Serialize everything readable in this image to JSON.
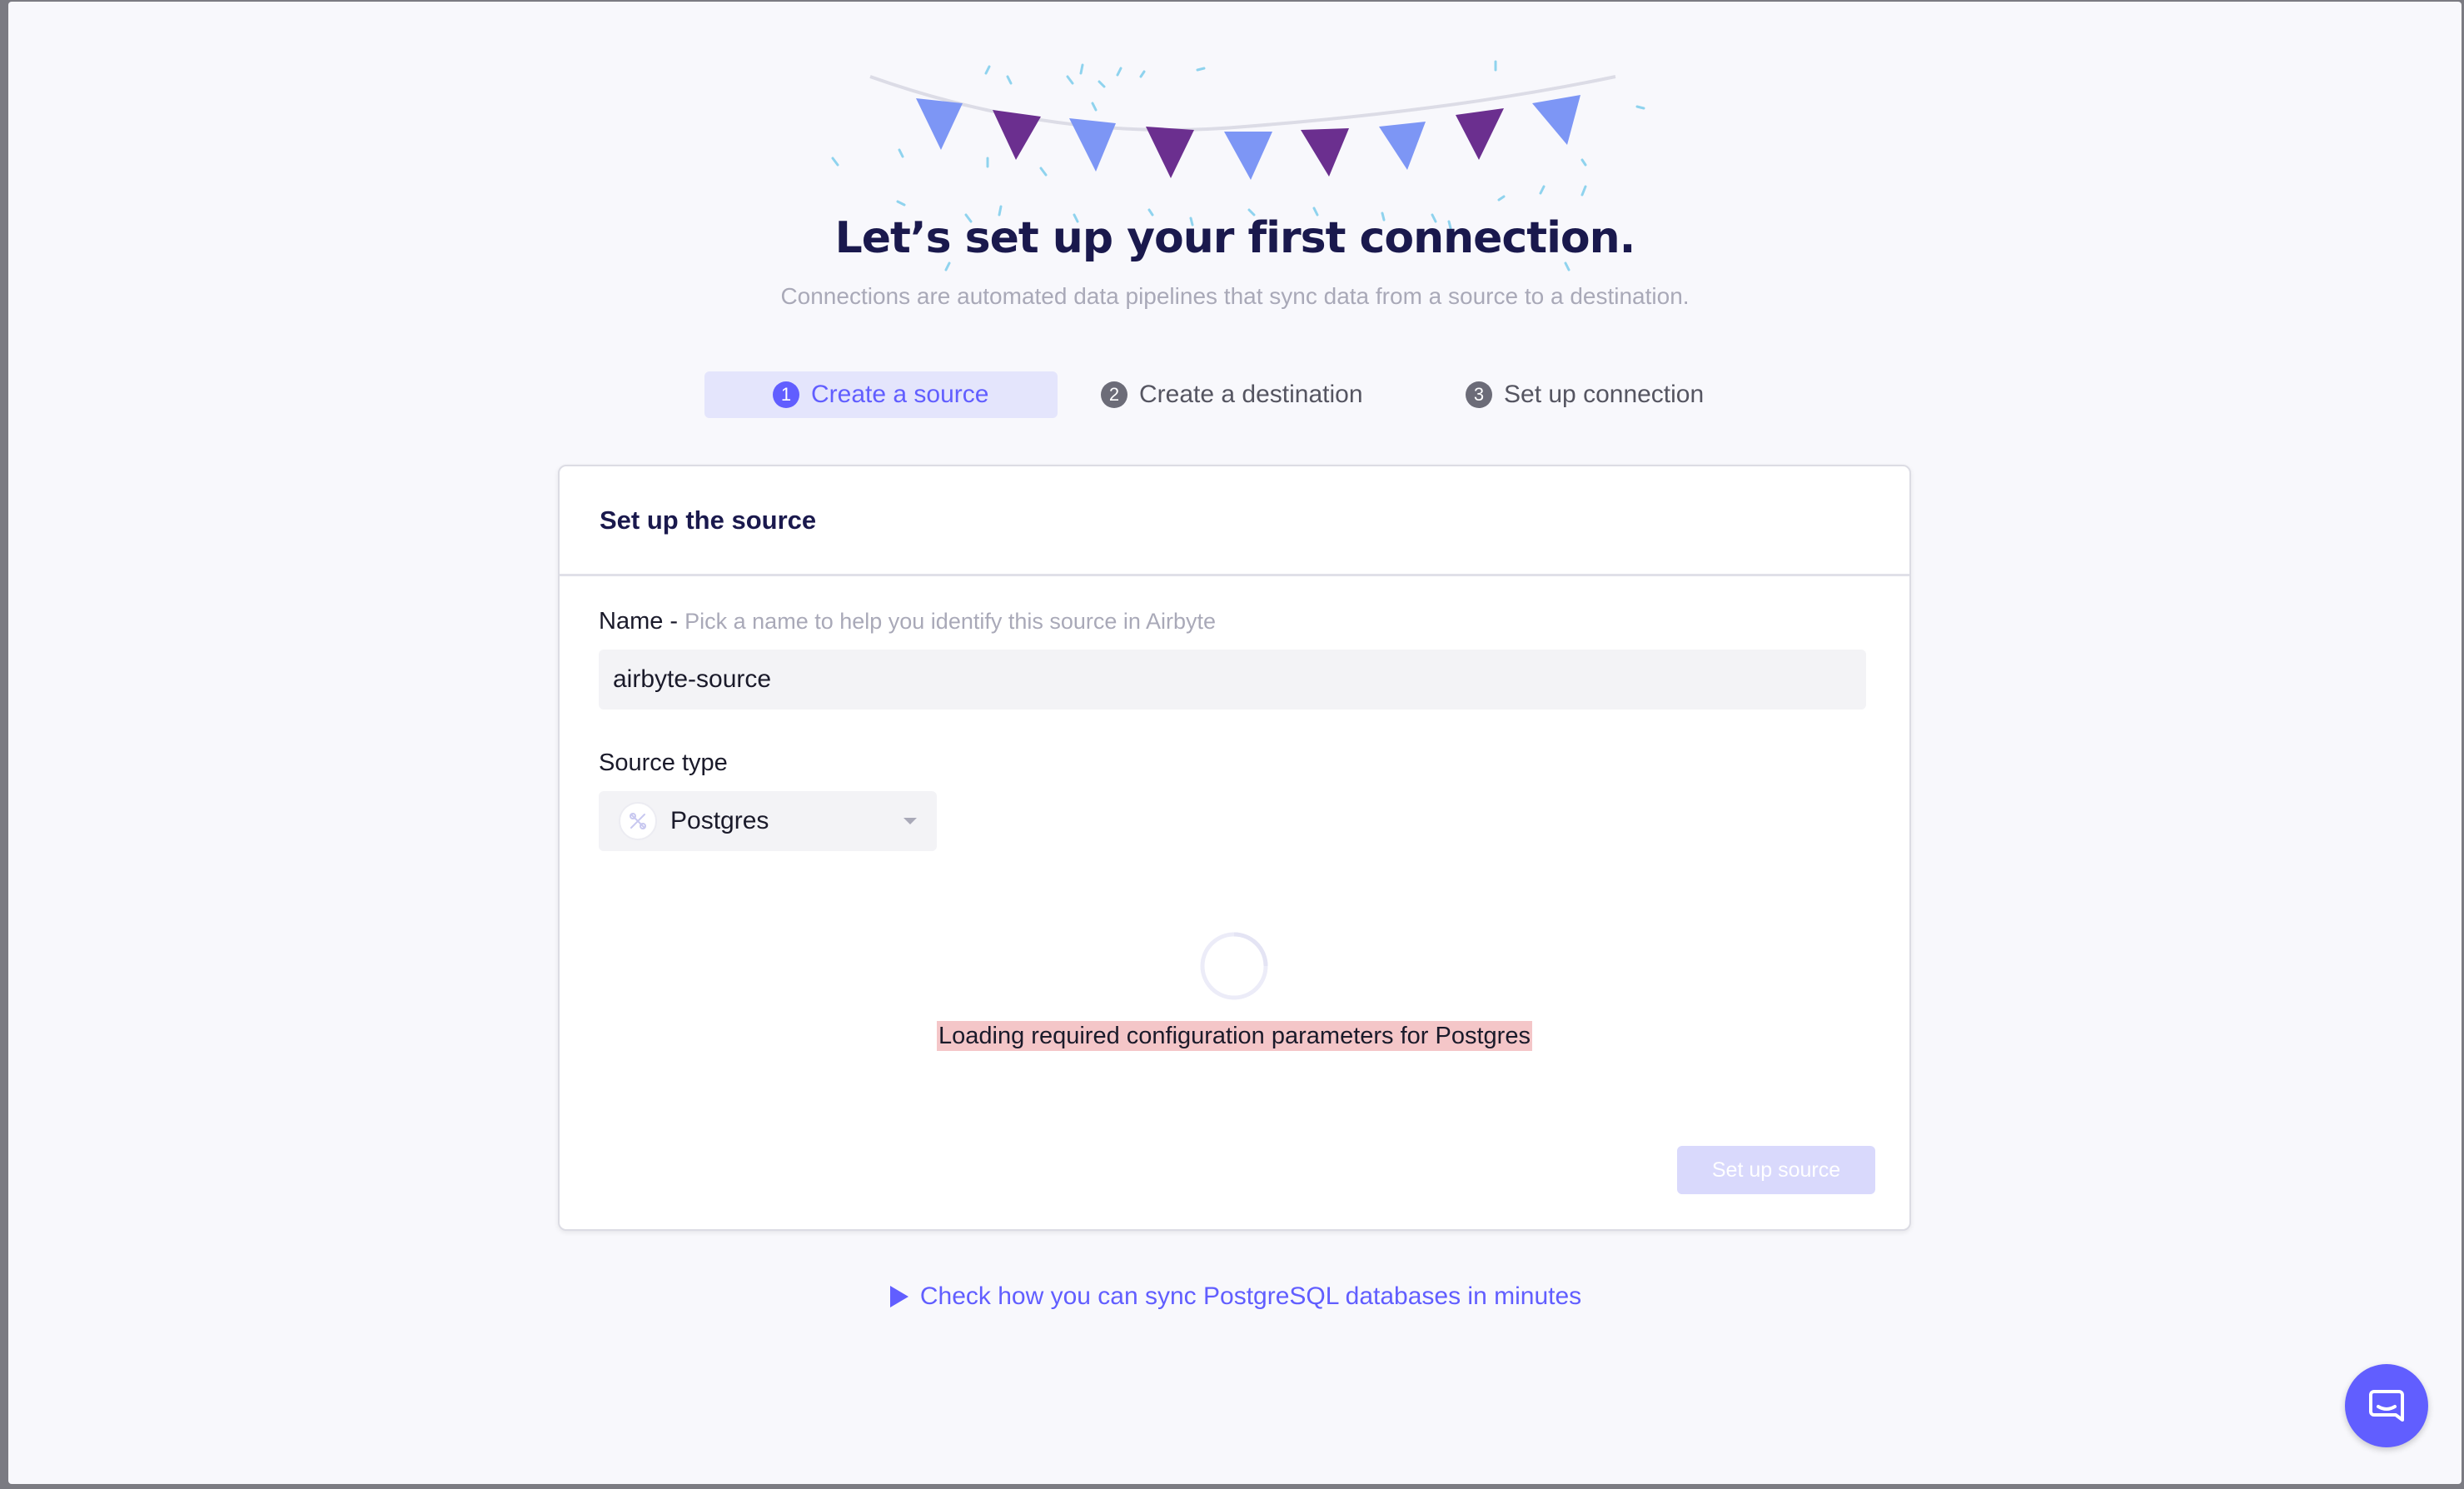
{
  "header": {
    "title": "Let’s set up your first connection.",
    "subtitle": "Connections are automated data pipelines that sync data from a source to a destination."
  },
  "steps": [
    {
      "number": "1",
      "label": "Create a source",
      "active": true
    },
    {
      "number": "2",
      "label": "Create a destination",
      "active": false
    },
    {
      "number": "3",
      "label": "Set up connection",
      "active": false
    }
  ],
  "form": {
    "title": "Set up the source",
    "name_label": "Name -",
    "name_hint": "Pick a name to help you identify this source in Airbyte",
    "name_value": "airbyte-source",
    "source_type_label": "Source type",
    "source_type_value": "Postgres",
    "loading_text": "Loading required configuration parameters for Postgres",
    "submit_label": "Set up source"
  },
  "footer": {
    "video_link": "Check how you can sync PostgreSQL databases in minutes"
  },
  "colors": {
    "accent": "#615eff",
    "title": "#1a194d",
    "flag_light": "#7d96f5",
    "flag_dark": "#6b2f8f"
  },
  "icons": [
    "bunting-decoration",
    "source-connector-icon",
    "chevron-down-icon",
    "spinner-icon",
    "play-icon",
    "chat-icon"
  ]
}
